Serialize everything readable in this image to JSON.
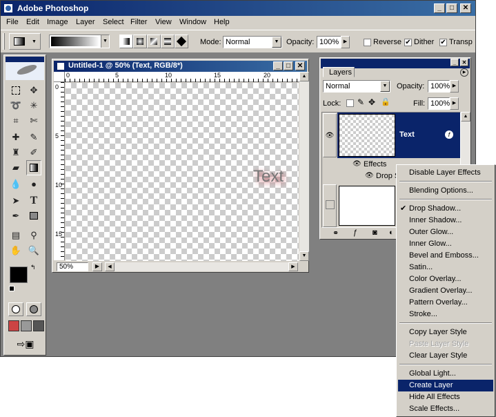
{
  "app": {
    "title": "Adobe Photoshop"
  },
  "menu": [
    "File",
    "Edit",
    "Image",
    "Layer",
    "Select",
    "Filter",
    "View",
    "Window",
    "Help"
  ],
  "options": {
    "mode_label": "Mode:",
    "mode_value": "Normal",
    "opacity_label": "Opacity:",
    "opacity_value": "100%",
    "reverse_label": "Reverse",
    "dither_label": "Dither",
    "transp_label": "Transp",
    "dither_checked": "✔",
    "transp_checked": "✔"
  },
  "document": {
    "title": "Untitled-1 @ 50% (Text, RGB/8*)",
    "zoom": "50%",
    "layer_text": "Text",
    "ruler_top": [
      "0",
      "5",
      "10",
      "15",
      "20"
    ],
    "ruler_left": [
      "0",
      "5",
      "10",
      "15"
    ]
  },
  "layers": {
    "tab": "Layers",
    "blend_mode": "Normal",
    "opacity_label": "Opacity:",
    "opacity_value": "100%",
    "lock_label": "Lock:",
    "fill_label": "Fill:",
    "fill_value": "100%",
    "layer_name": "Text",
    "effects_label": "Effects",
    "drop_shadow_label": "Drop Sh"
  },
  "context_menu": {
    "items": [
      "Disable Layer Effects",
      "Blending Options...",
      "Drop Shadow...",
      "Inner Shadow...",
      "Outer Glow...",
      "Inner Glow...",
      "Bevel and Emboss...",
      "Satin...",
      "Color Overlay...",
      "Gradient Overlay...",
      "Pattern Overlay...",
      "Stroke...",
      "Copy Layer Style",
      "Paste Layer Style",
      "Clear Layer Style",
      "Global Light...",
      "Create Layer",
      "Hide All Effects",
      "Scale Effects..."
    ],
    "checkmark": "✔"
  }
}
